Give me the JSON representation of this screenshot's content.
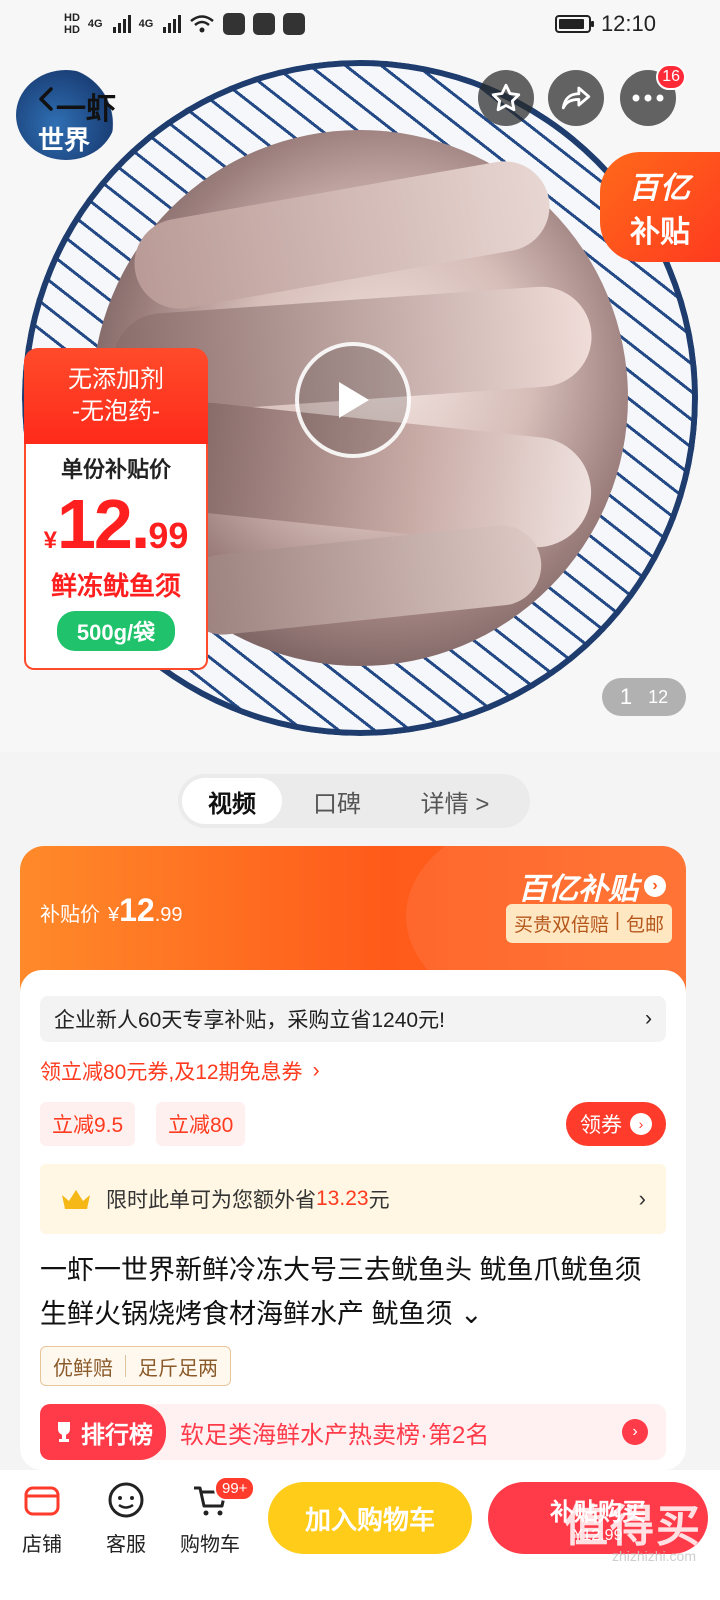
{
  "status_bar": {
    "time": "12:10",
    "hd1": "HD",
    "hd2": "HD",
    "net1": "4G",
    "net2": "4G",
    "battery_level": 0.9
  },
  "hero": {
    "logo_text_line1": "一虾",
    "logo_text_line2": "世界",
    "more_badge": "16",
    "subsidy_tag_line1": "百亿",
    "subsidy_tag_line2": "补贴",
    "promo": {
      "top_line1": "无添加剂",
      "top_line2": "-无泡药-",
      "label": "单份补贴价",
      "currency": "¥",
      "price_int": "12.",
      "price_dec": "99",
      "name": "鲜冻鱿鱼须",
      "spec": "500g/袋"
    },
    "page_indicator": {
      "current": "1",
      "total": "12"
    }
  },
  "tabs": [
    {
      "label": "视频"
    },
    {
      "label": "口碑"
    },
    {
      "label": "详情 >"
    }
  ],
  "price_banner": {
    "label": "补贴价",
    "currency": "¥",
    "price_int": "12",
    "price_dec": ".99",
    "title": "百亿补贴",
    "tag1": "买贵双倍赔",
    "tag_sep": "|",
    "tag2": "包邮"
  },
  "offers": {
    "enterprise_text": "企业新人60天专享补贴，采购立省1240元!",
    "coupon_text": "领立减80元券,及12期免息券",
    "coupon_arrow": "›",
    "chip1": "立减9.5",
    "chip2": "立减80",
    "claim_button": "领券",
    "save_text_prefix": "限时此单可为您额外省",
    "save_amount": "13.23",
    "save_unit": "元"
  },
  "product": {
    "title": "一虾一世界新鲜冷冻大号三去鱿鱼头 鱿鱼爪鱿鱼须生鲜火锅烧烤食材海鲜水产 鱿鱼须 ⌄",
    "assure1": "优鲜赔",
    "assure2": "足斤足两",
    "rank_badge": "排行榜",
    "rank_text": "软足类海鲜水产热卖榜·第2名"
  },
  "bottom_bar": {
    "store": "店铺",
    "service": "客服",
    "cart": "购物车",
    "cart_badge": "99+",
    "add_cart": "加入购物车",
    "buy_line1": "补贴购买",
    "buy_line2": "¥12.99",
    "watermark": "值得买",
    "watermark_url": "zhizhizhi.com"
  },
  "colors": {
    "accent_red": "#ff3b2b",
    "accent_orange": "#ff5a1a",
    "add_cart_yellow": "#ffcc1a",
    "spec_green": "#20c26b"
  }
}
